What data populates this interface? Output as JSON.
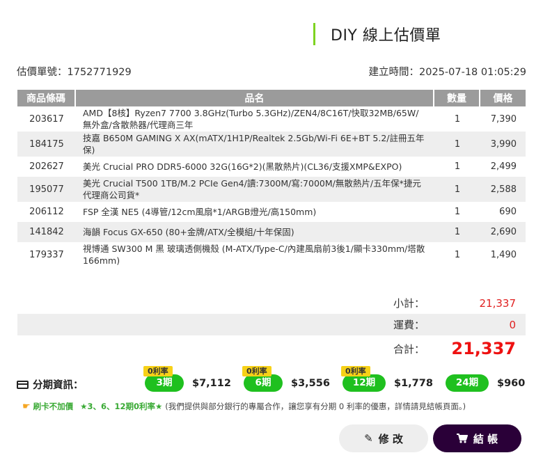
{
  "header": {
    "title": "DIY 線上估價單"
  },
  "meta": {
    "quote_no_label": "估價單號：",
    "quote_no": "1752771929",
    "created_label": "建立時間：",
    "created_at": "2025-07-18 01:05:29"
  },
  "table": {
    "headers": [
      "商品條碼",
      "品名",
      "數量",
      "價格"
    ],
    "rows": [
      {
        "code": "203617",
        "name": "AMD【8核】Ryzen7 7700 3.8GHz(Turbo 5.3GHz)/ZEN4/8C16T/快取32MB/65W/無外盒/含散熱器/代理商三年",
        "qty": "1",
        "price": "7,390"
      },
      {
        "code": "184175",
        "name": "技嘉 B650M GAMING X AX(mATX/1H1P/Realtek 2.5Gb/Wi-Fi 6E+BT 5.2/註冊五年保)",
        "qty": "1",
        "price": "3,990"
      },
      {
        "code": "202627",
        "name": "美光 Crucial PRO DDR5-6000 32G(16G*2)(黑散熱片)(CL36/支援XMP&EXPO)",
        "qty": "1",
        "price": "2,499"
      },
      {
        "code": "195077",
        "name": "美光 Crucial T500 1TB/M.2 PCIe Gen4/讀:7300M/寫:7000M/無散熱片/五年保*捷元代理商公司貨*",
        "qty": "1",
        "price": "2,588"
      },
      {
        "code": "206112",
        "name": "FSP 全漢 NE5 (4導管/12cm風扇*1/ARGB燈光/高150mm)",
        "qty": "1",
        "price": "690"
      },
      {
        "code": "141842",
        "name": "海韻 Focus GX-650 (80+金牌/ATX/全模組/十年保固)",
        "qty": "1",
        "price": "2,690"
      },
      {
        "code": "179337",
        "name": "視博通 SW300 M 黑 玻璃透側機殼 (M-ATX/Type-C/內建風扇前3後1/顯卡330mm/塔散166mm)",
        "qty": "1",
        "price": "1,490"
      }
    ]
  },
  "totals": {
    "subtotal_label": "小計：",
    "subtotal": "21,337",
    "shipping_label": "運費：",
    "shipping": "0",
    "total_label": "合計：",
    "total": "21,337"
  },
  "installments": {
    "label": "分期資訊：",
    "zero_badge": "0利率",
    "plans": [
      {
        "period": "3期",
        "amount": "$7,112"
      },
      {
        "period": "6期",
        "amount": "$3,556"
      },
      {
        "period": "12期",
        "amount": "$1,778"
      },
      {
        "period": "24期",
        "amount": "$960"
      }
    ]
  },
  "note": {
    "a": "刷卡不加價",
    "b": "★3、6、12期0利率★",
    "c": "(我們提供與部分銀行的專屬合作，讓您享有分期 0 利率的優惠，詳情請見結帳頁面。)"
  },
  "actions": {
    "edit_label": "修 改",
    "checkout_label": "結 帳"
  },
  "colors": {
    "accent_green": "#1fc01f",
    "price_red": "#ee1111",
    "checkout_bg": "#2a0038",
    "badge_yellow": "#f7d117"
  },
  "icons": {
    "installment": "credit-card-icon",
    "edit": "pencil-icon",
    "checkout": "cart-icon",
    "note": "pointing-hand-icon"
  }
}
